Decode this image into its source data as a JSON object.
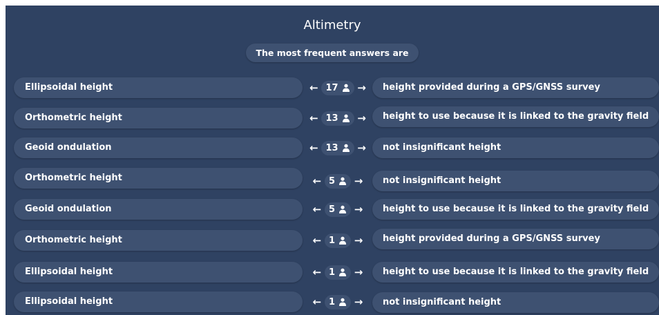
{
  "title": "Altimetry",
  "subtitle": "The most frequent answers are",
  "icons": {
    "arrow_left": "←",
    "arrow_right": "→",
    "user": "user-icon"
  },
  "colors": {
    "background": "#2f4262",
    "pill": "#3e5171",
    "text": "#ffffff"
  },
  "rows": [
    {
      "left": "Ellipsoidal height",
      "count": "17",
      "right": "height provided during a GPS/GNSS survey"
    },
    {
      "left": "Orthometric height",
      "count": "13",
      "right": "height to use because it is linked to the gravity field"
    },
    {
      "left": "Geoid ondulation",
      "count": "13",
      "right": "not insignificant height"
    },
    {
      "left": "Orthometric height",
      "count": "5",
      "right": "not insignificant height"
    },
    {
      "left": "Geoid ondulation",
      "count": "5",
      "right": "height to use because it is linked to the gravity field"
    },
    {
      "left": "Orthometric height",
      "count": "1",
      "right": "height provided during a GPS/GNSS survey"
    },
    {
      "left": "Ellipsoidal height",
      "count": "1",
      "right": "height to use because it is linked to the gravity field"
    },
    {
      "left": "Ellipsoidal height",
      "count": "1",
      "right": "not insignificant height"
    }
  ]
}
